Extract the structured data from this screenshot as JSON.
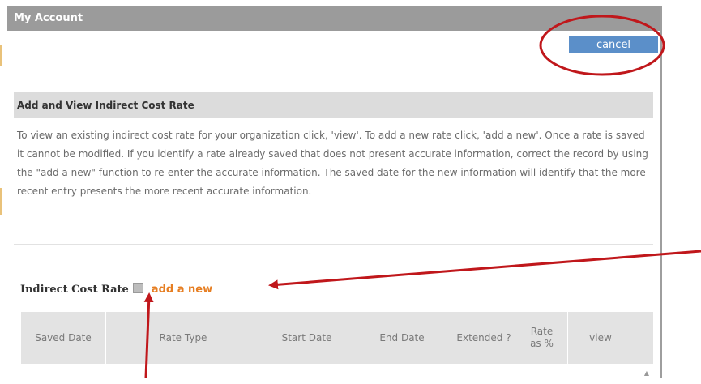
{
  "window": {
    "title": "My Account"
  },
  "actions": {
    "cancel_label": "cancel"
  },
  "section": {
    "title": "Add and View Indirect Cost Rate",
    "description": "To view an existing indirect cost rate for your organization click, 'view'. To add a new rate click, 'add a new'. Once a rate is saved it cannot be modified. If you identify a rate already saved that does not present accurate information, correct the record by using the \"add a new\" function to re-enter the accurate information. The saved date for the new information will identify that the more recent entry presents the more recent accurate information."
  },
  "indirect_cost_rate": {
    "label": "Indirect Cost Rate",
    "help_icon": "help-icon",
    "add_label": "add a new"
  },
  "table": {
    "columns": [
      "Saved Date",
      "Rate Type",
      "Start Date",
      "End Date",
      "Extended ?",
      "Rate as %",
      "view"
    ]
  },
  "colors": {
    "titlebar": "#9b9b9b",
    "cancel_button": "#5b8fc9",
    "link": "#e67e22",
    "annotation": "#c0171b"
  }
}
